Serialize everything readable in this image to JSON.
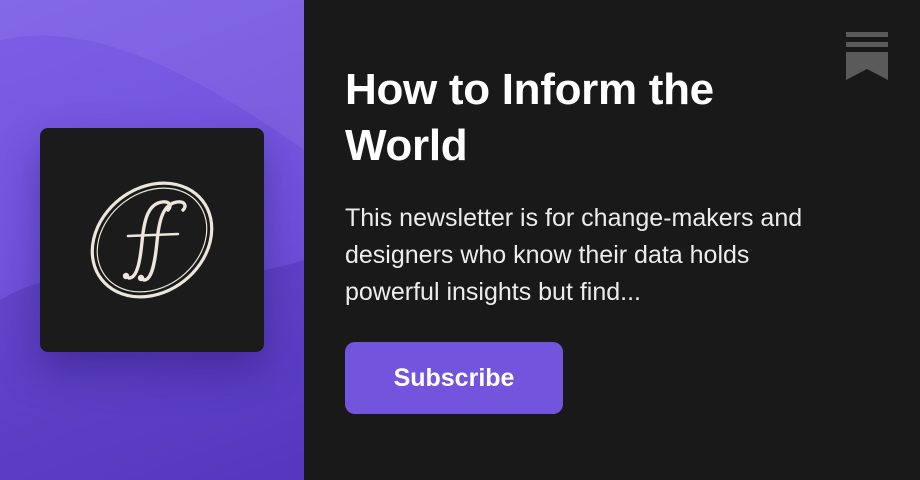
{
  "card": {
    "title": "How to Inform the World",
    "description": "This newsletter is for change-makers and designers who know their data holds powerful insights but find...",
    "subscribe_label": "Subscribe"
  },
  "logo": {
    "icon": "ff-ligature-monogram",
    "text": "ff"
  },
  "icons": {
    "corner": "bookmark-icon"
  },
  "colors": {
    "accent": "#7354dc",
    "left_panel": "#7557e0",
    "background": "#191919",
    "logo_tile": "#1b1b1b",
    "logo_stroke": "#ece6dc"
  }
}
